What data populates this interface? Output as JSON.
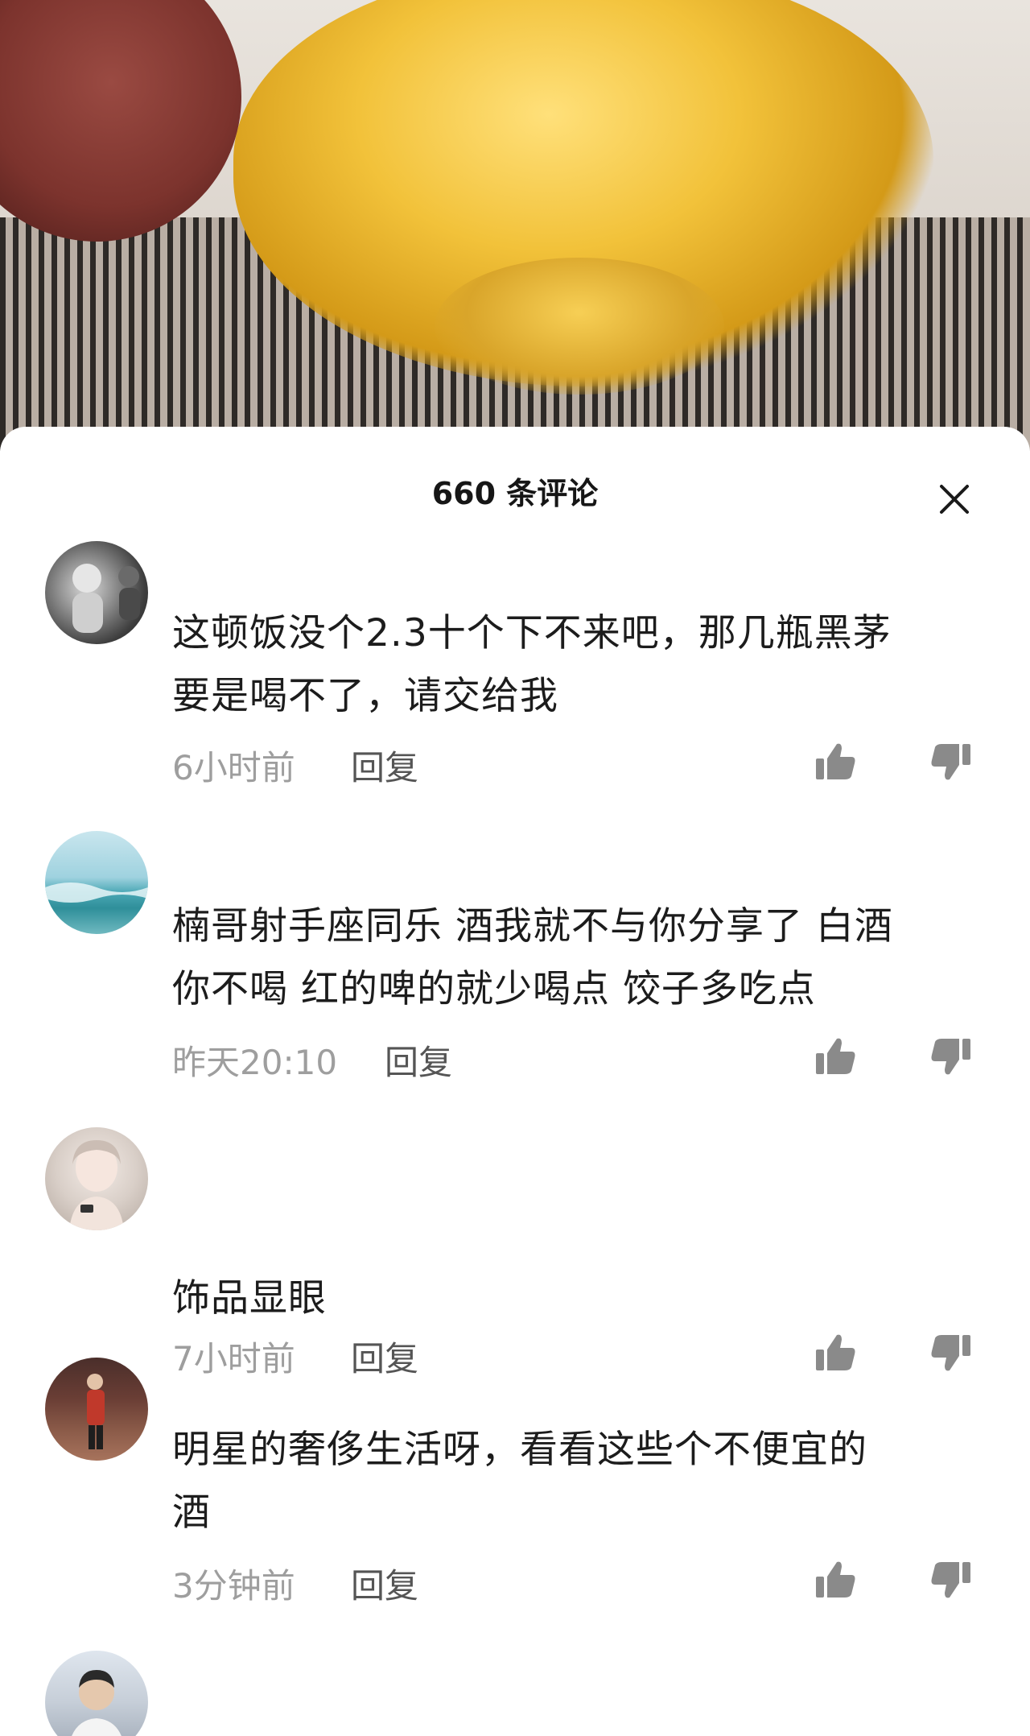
{
  "header": {
    "title": "660 条评论"
  },
  "comments": [
    {
      "text": "这顿饭没个2.3十个下不来吧，那几瓶黑茅\n要是喝不了，请交给我",
      "time": "6小时前",
      "reply_label": "回复"
    },
    {
      "text": "楠哥射手座同乐 酒我就不与你分享了 白酒\n你不喝 红的啤的就少喝点 饺子多吃点",
      "time": "昨天20:10",
      "reply_label": "回复"
    },
    {
      "text": "饰品显眼",
      "time": "7小时前",
      "reply_label": "回复"
    },
    {
      "text": "明星的奢侈生活呀，看看这些个不便宜的\n酒",
      "time": "3分钟前",
      "reply_label": "回复"
    }
  ],
  "colors": {
    "text_primary": "#1c1c1c",
    "text_meta": "#9e9e9e",
    "icon": "#8a8a8a"
  },
  "icons": {
    "close": "close-icon",
    "like": "thumbs-up-icon",
    "dislike": "thumbs-down-icon"
  }
}
